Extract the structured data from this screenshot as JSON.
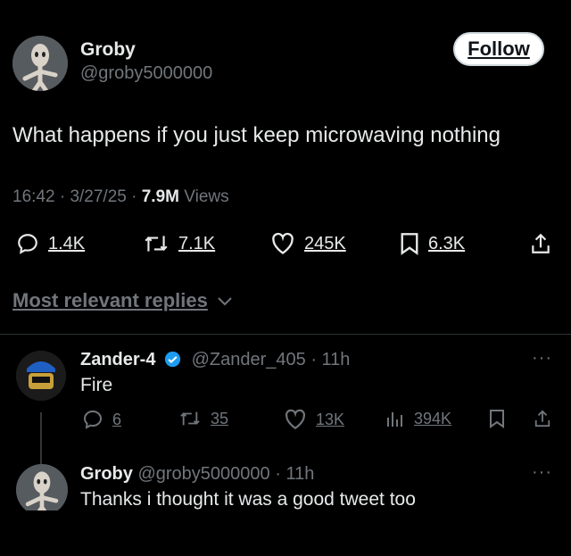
{
  "tweet": {
    "author_name": "Groby",
    "author_handle": "@groby5000000",
    "follow_label": "Follow",
    "text": "What happens if you just keep microwaving nothing",
    "time": "16:42",
    "date": "3/27/25",
    "views_count": "7.9M",
    "views_label": "Views",
    "replies": "1.4K",
    "reposts": "7.1K",
    "likes": "245K",
    "bookmarks": "6.3K",
    "icons": [
      "reply-icon",
      "repost-icon",
      "like-icon",
      "bookmark-icon",
      "share-icon"
    ]
  },
  "sort": {
    "label": "Most relevant replies"
  },
  "replies": [
    {
      "name": "Zander-4",
      "handle": "@Zander_405",
      "time": "11h",
      "text": "Fire",
      "replies": "6",
      "reposts": "35",
      "likes": "13K",
      "views": "394K"
    },
    {
      "name": "Groby",
      "handle": "@groby5000000",
      "time": "11h",
      "text": "Thanks i thought it was a good tweet too"
    }
  ],
  "colors": {
    "background": "#000000",
    "text": "#e7e9ea",
    "muted": "#71767b",
    "verified": "#1d9bf0"
  }
}
